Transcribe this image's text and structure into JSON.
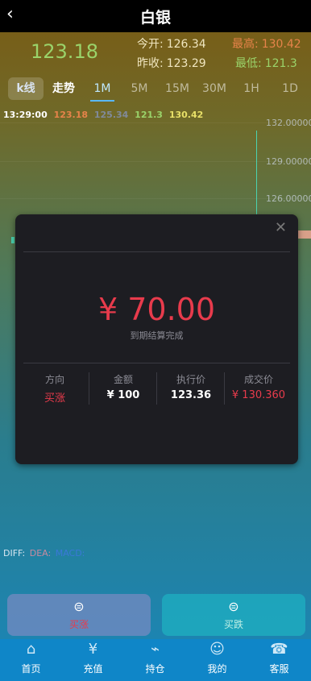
{
  "header": {
    "title": "白银",
    "back_icon": "chevron-left-icon"
  },
  "quote": {
    "price": "123.18",
    "open_label": "今开:",
    "open_value": "126.34",
    "high_label": "最高:",
    "high_value": "130.42",
    "prev_close_label": "昨收:",
    "prev_close_value": "123.29",
    "low_label": "最低:",
    "low_value": "121.3"
  },
  "tabs": [
    "k线",
    "走势",
    "1M",
    "5M",
    "15M",
    "30M",
    "1H",
    "1D"
  ],
  "chart_info": {
    "time": "13:29:00",
    "v1": "123.18",
    "v2": "125.34",
    "v3": "121.3",
    "v4": "130.42"
  },
  "y_axis": [
    "132.00000",
    "129.00000",
    "126.00000"
  ],
  "indicators": {
    "diff": "DIFF:",
    "dea": "DEA:",
    "macd": "MACD:"
  },
  "modal": {
    "amount": "¥ 70.00",
    "status": "到期结算完成",
    "columns": [
      {
        "header": "方向",
        "value": "买涨"
      },
      {
        "header": "金额",
        "value": "¥ 100"
      },
      {
        "header": "执行价",
        "value": "123.36"
      },
      {
        "header": "成交价",
        "value": "¥ 130.360"
      }
    ]
  },
  "actions": {
    "buy_up": "买涨",
    "buy_down": "买跌"
  },
  "nav": [
    {
      "label": "首页",
      "icon": "home-icon"
    },
    {
      "label": "充值",
      "icon": "wallet-icon"
    },
    {
      "label": "持仓",
      "icon": "chart-icon"
    },
    {
      "label": "我的",
      "icon": "user-icon"
    },
    {
      "label": "客服",
      "icon": "support-icon"
    }
  ],
  "colors": {
    "up_red": "#e83b4c",
    "green": "#9ad36a",
    "orange": "#e6834a",
    "yellow": "#e8e068",
    "blue": "#3a78d8"
  }
}
